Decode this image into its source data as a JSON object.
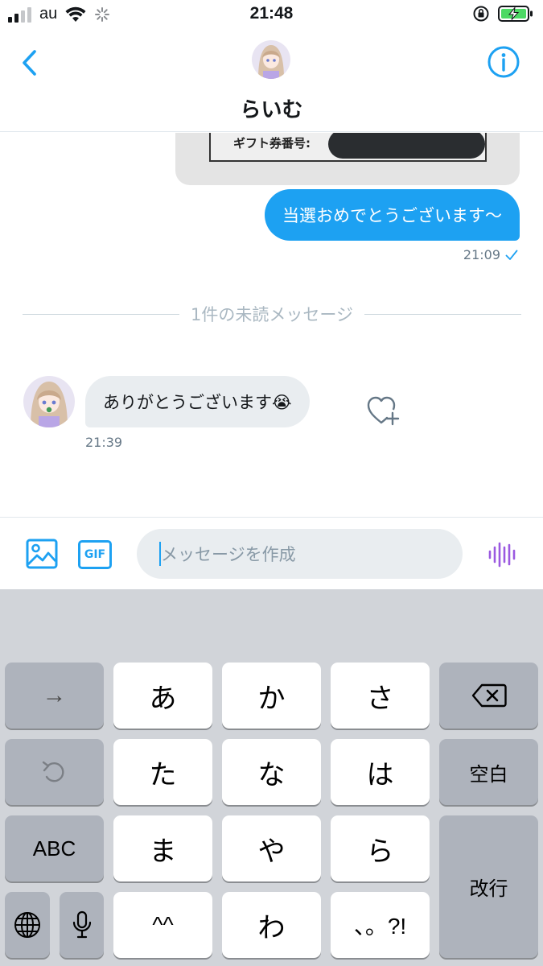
{
  "status_bar": {
    "carrier": "au",
    "time": "21:48",
    "signal_bars_active": 2,
    "signal_bars_total": 4,
    "battery_charging": true,
    "battery_color": "#4cd964"
  },
  "header": {
    "title": "らいむ",
    "back_icon": "chevron-left-icon",
    "info_icon": "info-icon",
    "accent_color": "#1da1f2"
  },
  "chat": {
    "gift_image": {
      "label": "ギフト券番号:"
    },
    "outgoing": {
      "text": "当選おめでとうございます〜",
      "time": "21:09",
      "status_icon": "checkmark-icon"
    },
    "unread_divider": "1件の未読メッセージ",
    "incoming": {
      "text": "ありがとうございます😭",
      "time": "21:39",
      "reaction_icon": "heart-plus-icon"
    }
  },
  "composer": {
    "placeholder": "メッセージを作成",
    "gif_label": "GIF",
    "media_icon": "image-icon",
    "voice_icon": "voice-waveform-icon"
  },
  "keyboard": {
    "row1": {
      "left": "→",
      "k1": "あ",
      "k2": "か",
      "k3": "さ",
      "right_icon": "backspace-icon"
    },
    "row2": {
      "left_icon": "undo-icon",
      "k1": "た",
      "k2": "な",
      "k3": "は",
      "right": "空白"
    },
    "row3": {
      "left": "ABC",
      "k1": "ま",
      "k2": "や",
      "k3": "ら",
      "right": "改行"
    },
    "row4": {
      "globe_icon": "globe-icon",
      "mic_icon": "microphone-icon",
      "k1": "^^",
      "k2": "わ",
      "k3": "、。?!"
    }
  }
}
